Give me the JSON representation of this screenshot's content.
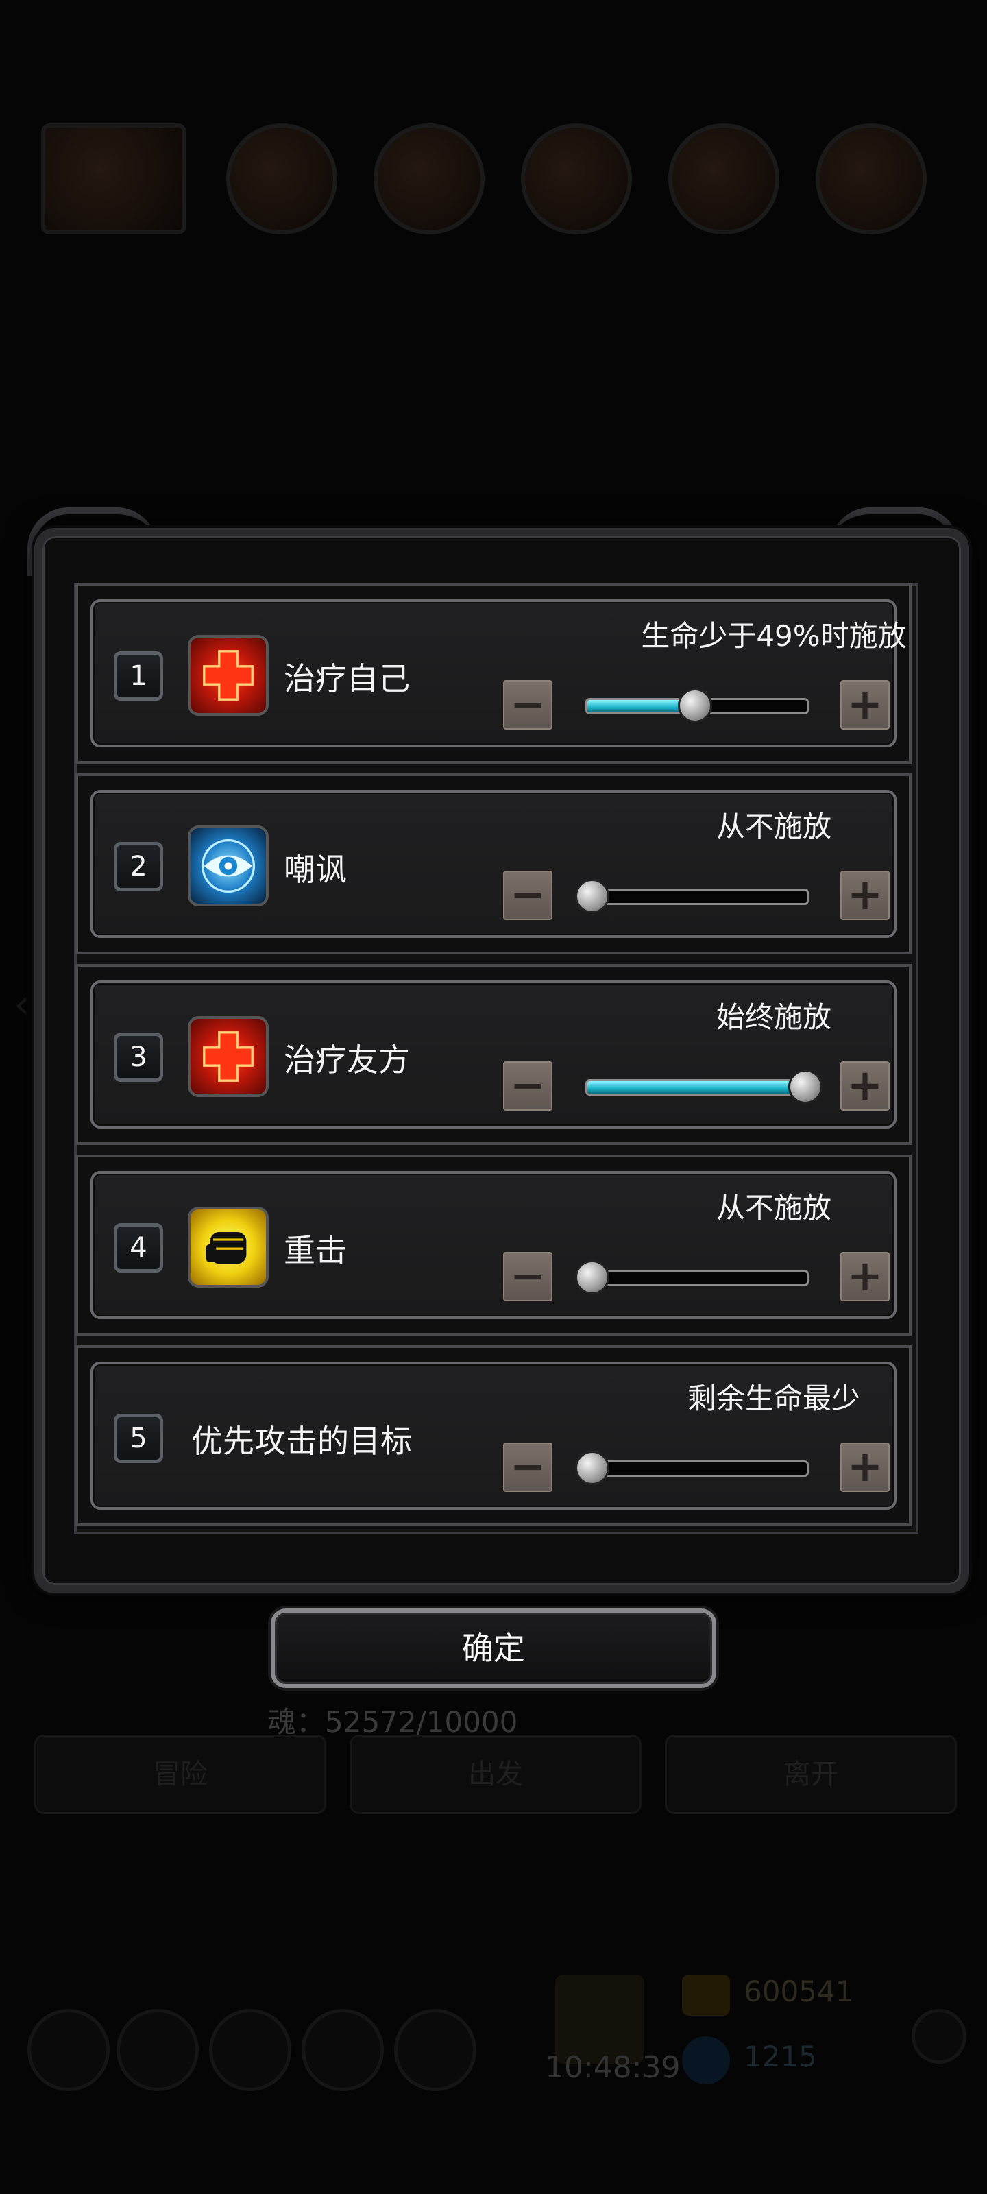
{
  "background": {
    "buttons": [
      "冒险",
      "出发",
      "离开"
    ],
    "soul": "魂：52572/10000",
    "clock": "10:48:39",
    "gold": "600541",
    "gems": "1215"
  },
  "dialog": {
    "rows": [
      {
        "number": "1",
        "name": "治疗自己",
        "icon": "heal-cross-icon",
        "setting": "生命少于49%时施放",
        "slider_fraction": 0.49
      },
      {
        "number": "2",
        "name": "嘲讽",
        "icon": "eye-taunt-icon",
        "setting": "从不施放",
        "slider_fraction": 0.0
      },
      {
        "number": "3",
        "name": "治疗友方",
        "icon": "heal-cross-icon",
        "setting": "始终施放",
        "slider_fraction": 1.0
      },
      {
        "number": "4",
        "name": "重击",
        "icon": "fist-icon",
        "setting": "从不施放",
        "slider_fraction": 0.0
      },
      {
        "number": "5",
        "name": "优先攻击的目标",
        "icon": "",
        "setting": "剩余生命最少",
        "slider_fraction": 0.0
      }
    ],
    "minus_glyph": "−",
    "plus_glyph": "+",
    "confirm_label": "确定"
  },
  "colors": {
    "slider_fill": "#1bb3c8",
    "frame": "#2a2a2c"
  }
}
